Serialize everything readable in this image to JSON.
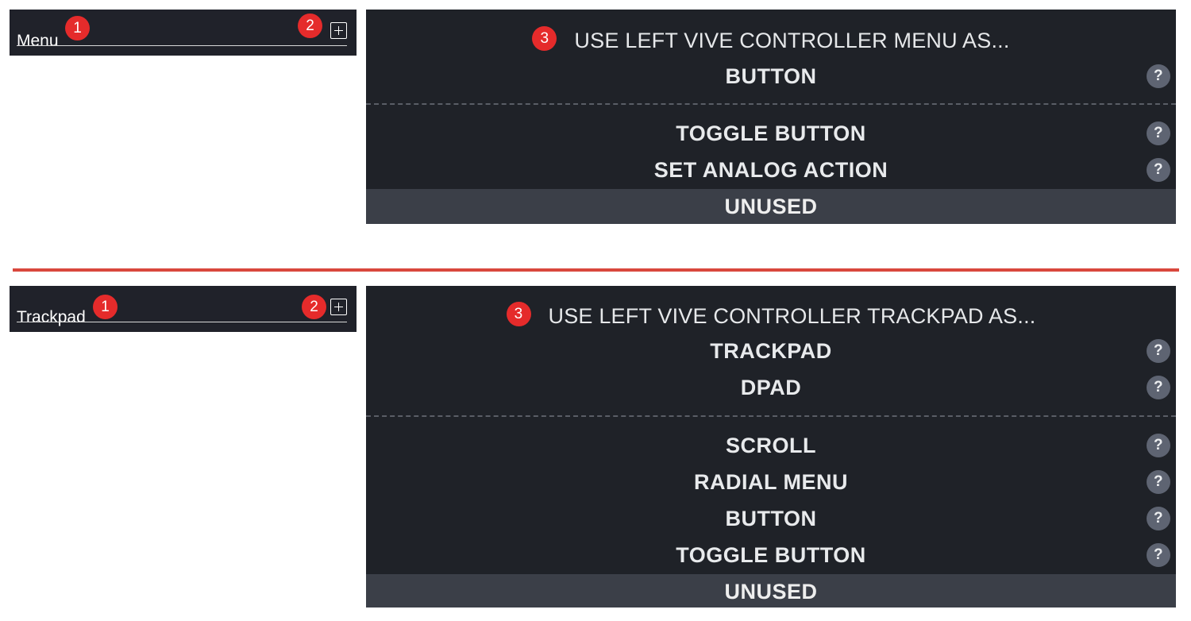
{
  "sections": [
    {
      "header_label": "Menu",
      "badge_1": "1",
      "badge_2": "2",
      "add_icon": "plus-square-icon",
      "panel_badge": "3",
      "panel_title": "USE LEFT VIVE CONTROLLER MENU AS...",
      "options": [
        {
          "label": "BUTTON",
          "help": "?"
        },
        {
          "label": "TOGGLE BUTTON",
          "help": "?"
        },
        {
          "label": "SET ANALOG ACTION",
          "help": "?"
        },
        {
          "label": "UNUSED",
          "selected": true
        }
      ]
    },
    {
      "header_label": "Trackpad",
      "badge_1": "1",
      "badge_2": "2",
      "add_icon": "plus-square-icon",
      "panel_badge": "3",
      "panel_title": "USE LEFT VIVE CONTROLLER TRACKPAD AS...",
      "options": [
        {
          "label": "TRACKPAD",
          "help": "?"
        },
        {
          "label": "DPAD",
          "help": "?"
        },
        {
          "label": "SCROLL",
          "help": "?"
        },
        {
          "label": "RADIAL MENU",
          "help": "?"
        },
        {
          "label": "BUTTON",
          "help": "?"
        },
        {
          "label": "TOGGLE BUTTON",
          "help": "?"
        },
        {
          "label": "UNUSED",
          "selected": true
        }
      ]
    }
  ],
  "colors": {
    "header_bg": "#20222a",
    "panel_bg": "#1f2228",
    "selected_bg": "#3b3f48",
    "badge": "#e52b2b",
    "help_icon": "#5e6472",
    "divider": "#d9473d"
  }
}
